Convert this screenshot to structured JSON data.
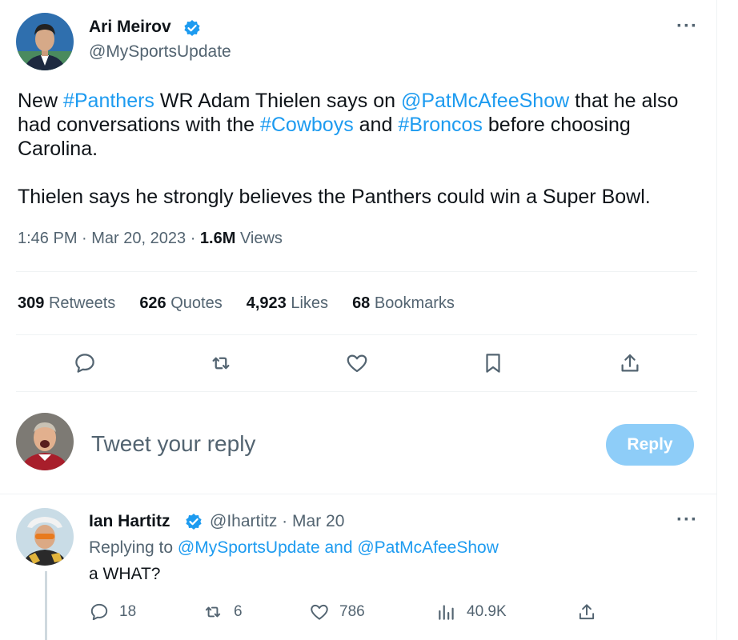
{
  "tweet": {
    "author_name": "Ari Meirov",
    "author_handle": "@MySportsUpdate",
    "text": {
      "p1": {
        "s1": "New ",
        "l1": "#Panthers",
        "s2": " WR Adam Thielen says on ",
        "l2": "@PatMcAfeeShow",
        "s3": " that he also had conversations with the ",
        "l3": "#Cowboys",
        "s4": " and ",
        "l4": "#Broncos",
        "s5": " before choosing Carolina."
      },
      "p2": "Thielen says he strongly believes the Panthers could win a Super Bowl."
    },
    "time": "1:46 PM",
    "date": "Mar 20, 2023",
    "views_count": "1.6M",
    "views_label": "Views",
    "stats": [
      {
        "count": "309",
        "label": "Retweets"
      },
      {
        "count": "626",
        "label": "Quotes"
      },
      {
        "count": "4,923",
        "label": "Likes"
      },
      {
        "count": "68",
        "label": "Bookmarks"
      }
    ]
  },
  "actions": [
    "reply-icon",
    "retweet-icon",
    "like-icon",
    "bookmark-icon",
    "share-icon"
  ],
  "composer": {
    "placeholder": "Tweet your reply",
    "button_label": "Reply"
  },
  "reply": {
    "author_name": "Ian Hartitz",
    "author_handle": "@Ihartitz",
    "date": "Mar 20",
    "replying_to_label": "Replying to",
    "replying_to_users": "@MySportsUpdate and @PatMcAfeeShow",
    "text": "a WHAT?",
    "reply_count": "18",
    "retweet_count": "6",
    "like_count": "786",
    "view_count": "40.9K"
  },
  "colors": {
    "accent": "#1d9bf0",
    "reply_button_disabled": "#8ecdf8",
    "secondary_text": "#536471",
    "divider": "#eff3f4"
  }
}
